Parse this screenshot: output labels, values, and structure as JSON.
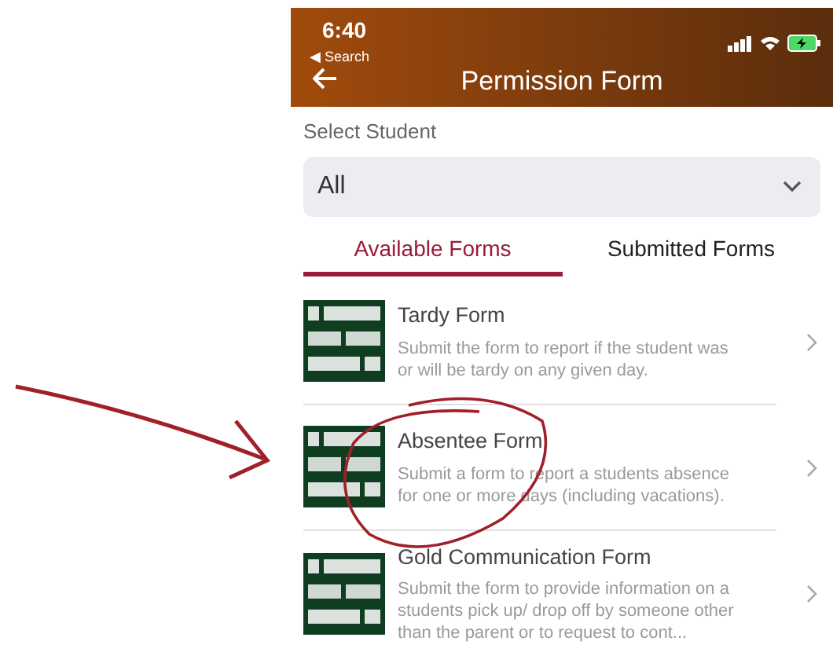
{
  "status_bar": {
    "time": "6:40",
    "back_label": "◀ Search"
  },
  "header": {
    "title": "Permission Form"
  },
  "select": {
    "label": "Select Student",
    "value": "All"
  },
  "tabs": [
    {
      "label": "Available Forms",
      "selected": true
    },
    {
      "label": "Submitted Forms",
      "selected": false
    }
  ],
  "forms": [
    {
      "title": "Tardy Form",
      "description": "Submit the form to report if the student was or will be tardy on any given day."
    },
    {
      "title": "Absentee Form",
      "description": "Submit a form to report a students absence for one or more days (including vacations)."
    },
    {
      "title": "Gold Communication Form",
      "description": "Submit the form to provide information on a students pick up/ drop off by someone other than the parent or to request to cont..."
    }
  ]
}
